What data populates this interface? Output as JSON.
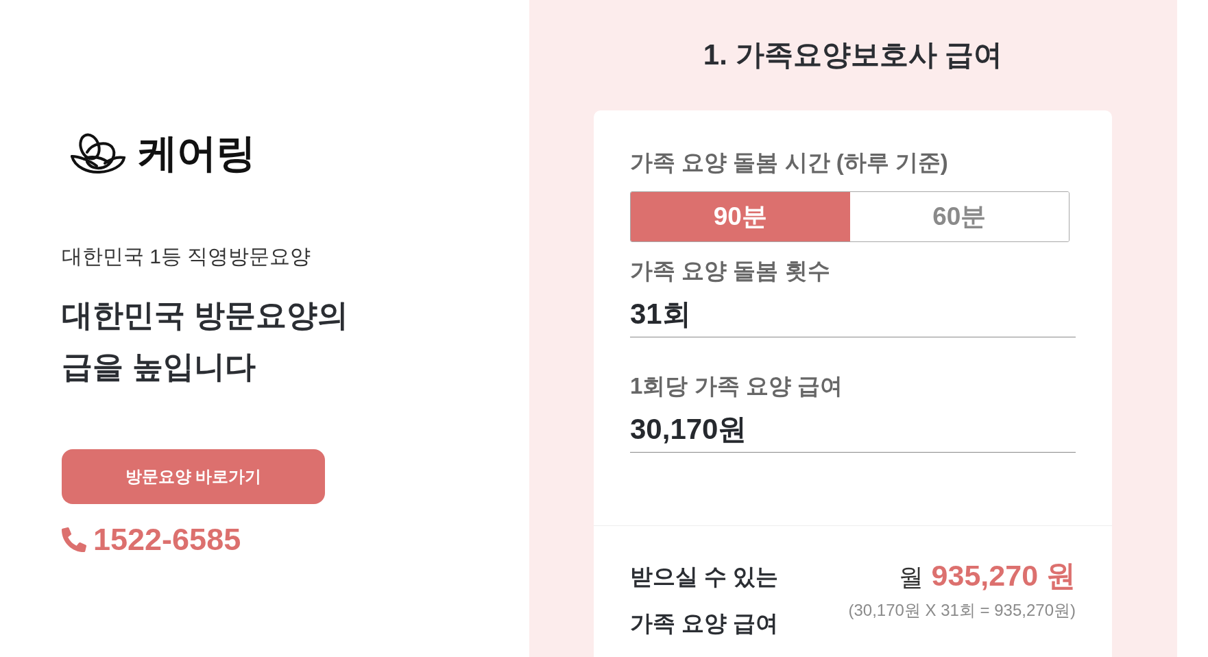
{
  "brand": {
    "name": "케어링"
  },
  "hero": {
    "tagline": "대한민국 1등 직영방문요양",
    "headline": [
      "대한민국 방문요양의",
      "급을 높입니다"
    ],
    "cta": "방문요양 바로가기",
    "phone": "1522-6585"
  },
  "calculator": {
    "title": "1. 가족요양보호사 급여",
    "fields": [
      {
        "kind": "toggle",
        "label": "가족 요양 돌봄 시간 (하루 기준)",
        "options": [
          {
            "label": "90분",
            "selected": true
          },
          {
            "label": "60분",
            "selected": false
          }
        ]
      },
      {
        "kind": "value",
        "label": "가족 요양 돌봄 횟수",
        "value": "31회"
      },
      {
        "kind": "value",
        "label": "1회당 가족 요양 급여",
        "value": "30,170원"
      }
    ],
    "result": {
      "label": [
        "받으실 수 있는",
        "가족 요양 급여"
      ],
      "prefix": "월",
      "amount": "935,270 원",
      "formula": "(30,170원 X 31회 = 935,270원)"
    }
  }
}
